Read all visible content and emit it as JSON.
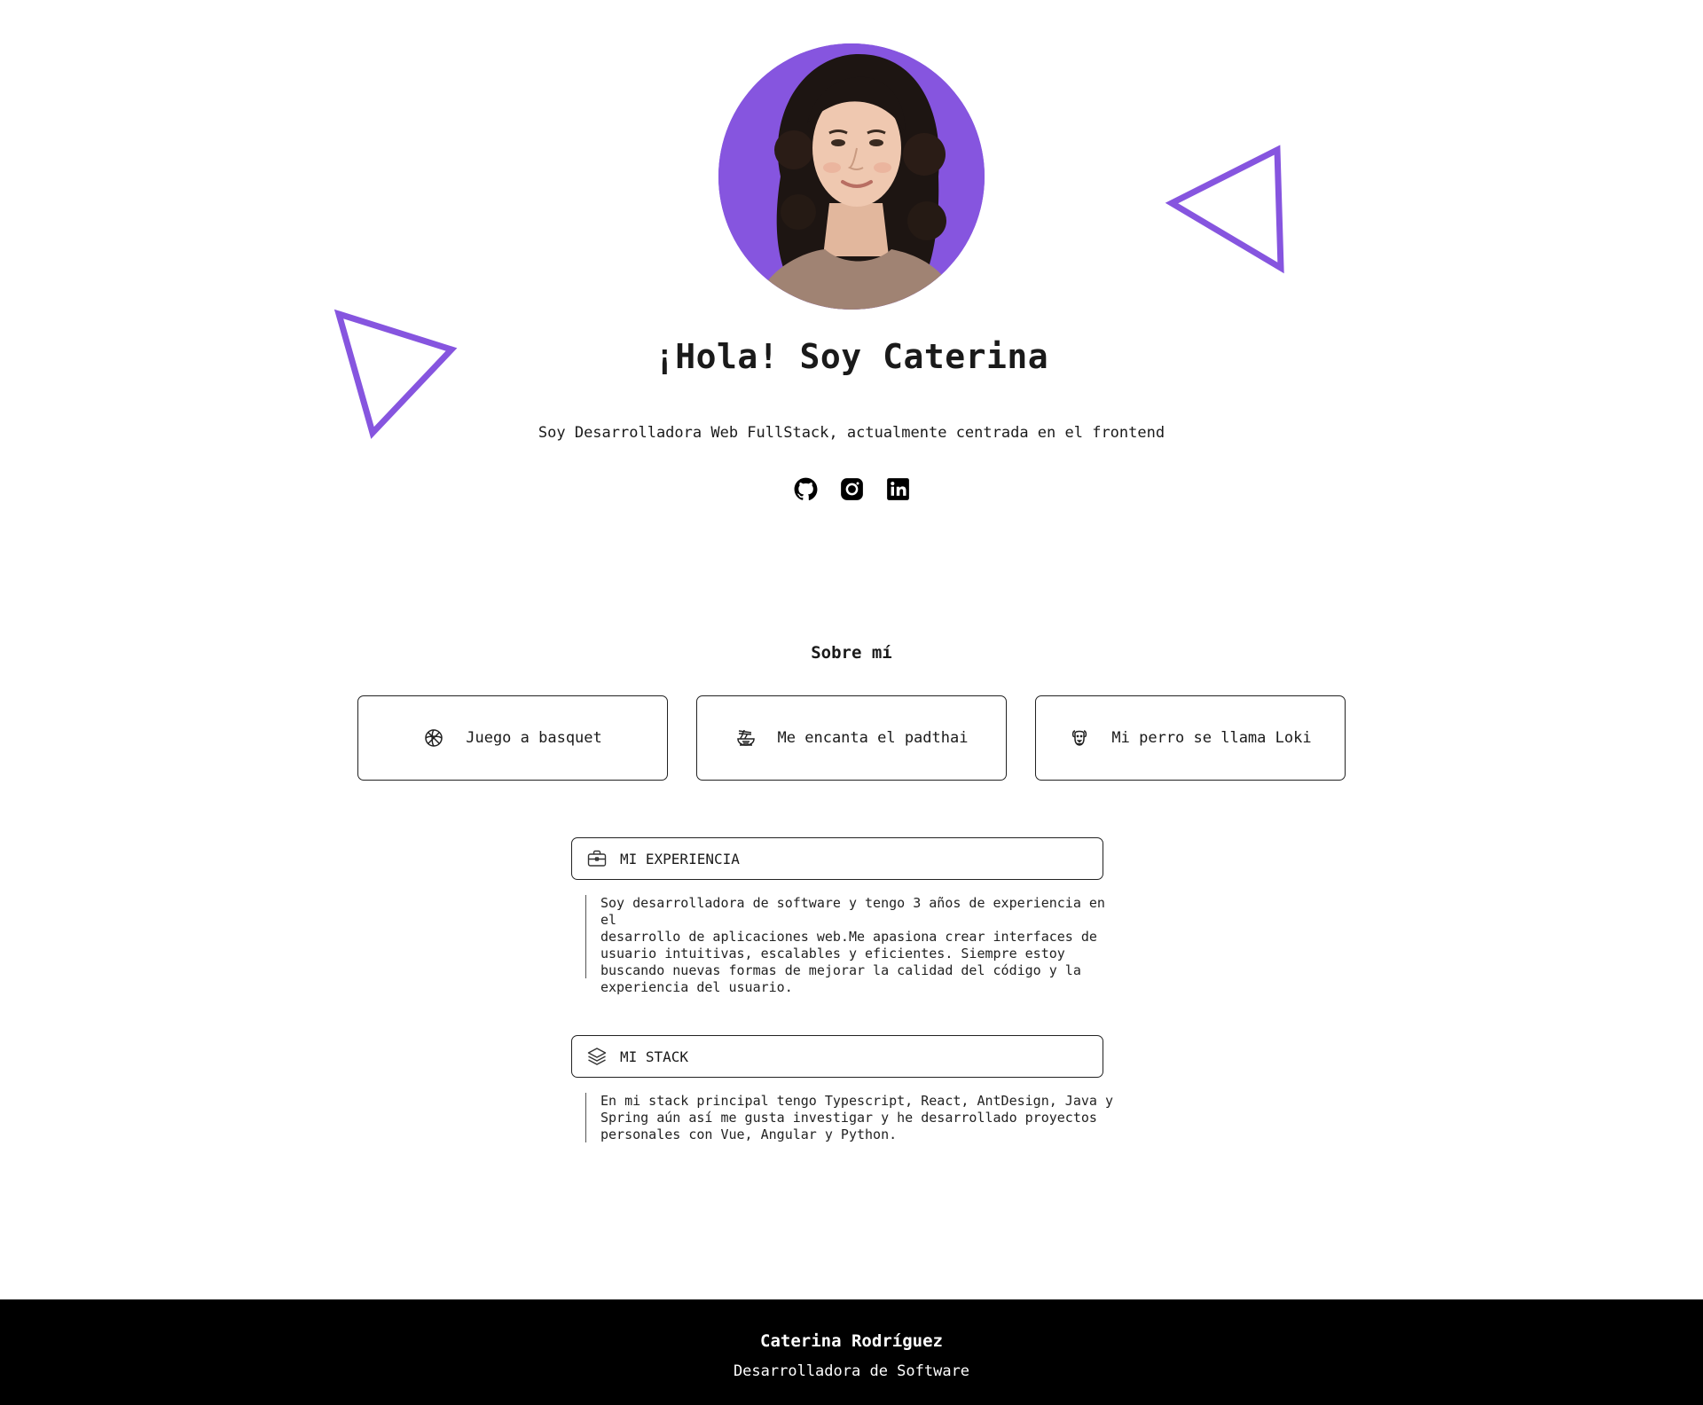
{
  "colors": {
    "accent": "#8655df",
    "text": "#1a1a1a",
    "footer_bg": "#000000",
    "footer_text": "#ffffff"
  },
  "hero": {
    "avatar_icon": "profile-photo",
    "title": "¡Hola! Soy Caterina",
    "subtitle": "Soy Desarrolladora Web FullStack, actualmente centrada en el frontend",
    "socials": [
      {
        "icon": "github-icon"
      },
      {
        "icon": "instagram-icon"
      },
      {
        "icon": "linkedin-icon"
      }
    ]
  },
  "about": {
    "title": "Sobre mí",
    "cards": [
      {
        "icon": "basketball-icon",
        "label": "Juego a basquet"
      },
      {
        "icon": "noodles-icon",
        "label": "Me encanta el padthai"
      },
      {
        "icon": "dog-icon",
        "label": "Mi perro se llama Loki"
      }
    ]
  },
  "experience": {
    "icon": "briefcase-icon",
    "title": "MI EXPERIENCIA",
    "text": "Soy desarrolladora de software y tengo 3 años de experiencia en el\ndesarrollo de aplicaciones web.Me apasiona crear interfaces de\nusuario intuitivas, escalables y eficientes. Siempre estoy\nbuscando nuevas formas de mejorar la calidad del código y la\nexperiencia del usuario."
  },
  "stack": {
    "icon": "layers-icon",
    "title": "MI STACK",
    "text": "En mi stack principal tengo Typescript, React, AntDesign, Java y\nSpring aún así me gusta investigar y he desarrollado proyectos\npersonales con Vue, Angular y Python."
  },
  "footer": {
    "name": "Caterina Rodríguez",
    "role": "Desarrolladora de Software"
  }
}
